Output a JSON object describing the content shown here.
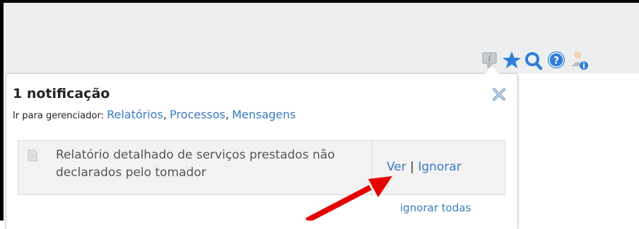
{
  "toolbar": {
    "icons": [
      {
        "name": "info-notification-icon"
      },
      {
        "name": "favorites-star-icon"
      },
      {
        "name": "search-icon"
      },
      {
        "name": "help-icon"
      },
      {
        "name": "user-info-icon"
      }
    ]
  },
  "popup": {
    "title": "1 notificação",
    "goto_label": "Ir para gerenciador:",
    "links": [
      "Relatórios",
      "Processos",
      "Mensagens"
    ],
    "separator": ",",
    "notification": {
      "text": "Relatório detalhado de serviços prestados não declarados pelo tomador",
      "view_label": "Ver",
      "divider": "|",
      "ignore_label": "Ignorar"
    },
    "ignore_all_label": "ignorar todas"
  },
  "colors": {
    "link": "#3a7abf",
    "topbar_bg": "#eceef0",
    "arrow": "#e60000",
    "star": "#2f7ed8"
  }
}
